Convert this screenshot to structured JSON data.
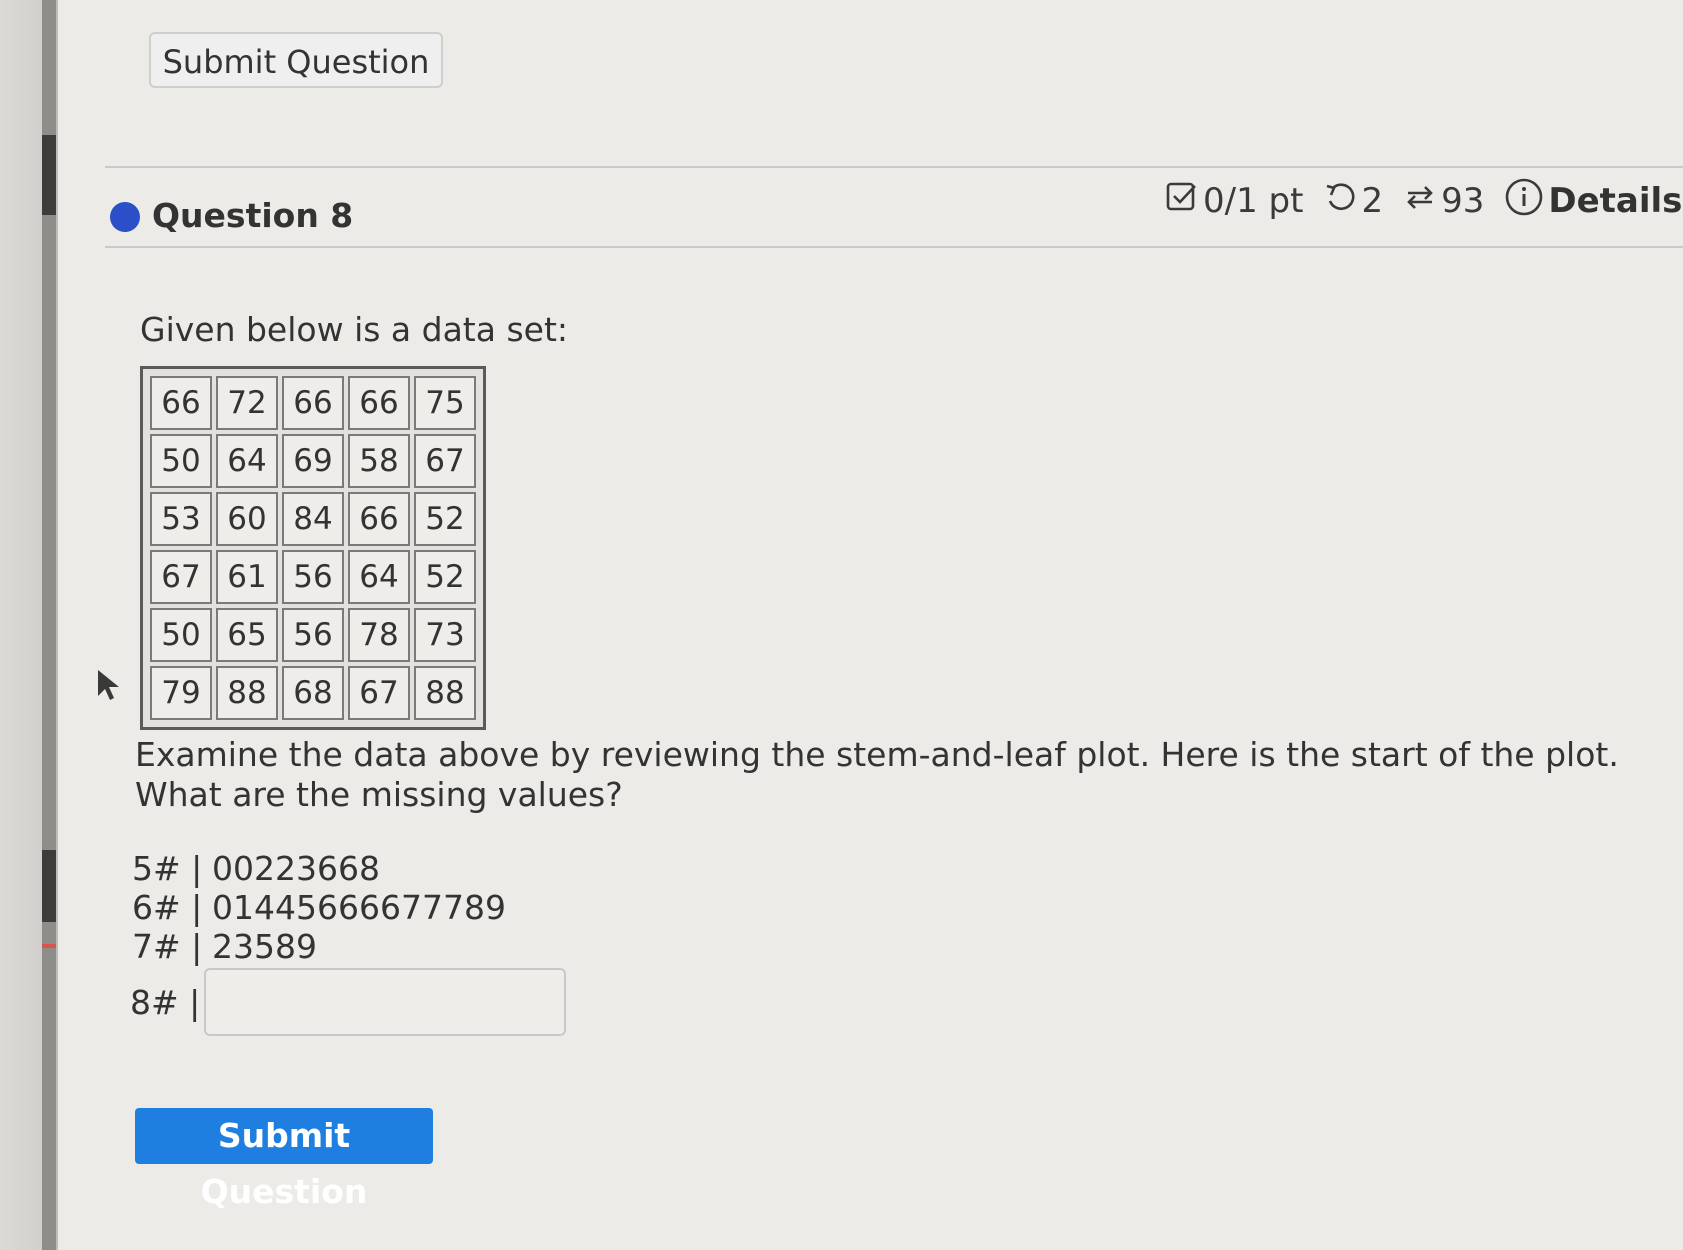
{
  "top_submit_label": "Submit Question",
  "question": {
    "title": "Question 8",
    "score": "0/1 pt",
    "retries": "2",
    "attempts": "93",
    "details_label": "Details"
  },
  "intro": "Given below is a data set:",
  "data_rows": [
    [
      "66",
      "72",
      "66",
      "66",
      "75"
    ],
    [
      "50",
      "64",
      "69",
      "58",
      "67"
    ],
    [
      "53",
      "60",
      "84",
      "66",
      "52"
    ],
    [
      "67",
      "61",
      "56",
      "64",
      "52"
    ],
    [
      "50",
      "65",
      "56",
      "78",
      "73"
    ],
    [
      "79",
      "88",
      "68",
      "67",
      "88"
    ]
  ],
  "prompt": "Examine the data above by reviewing the stem-and-leaf plot. Here is the start of the plot. What are the missing values?",
  "stem_plot": [
    {
      "stem": "5# |",
      "leaves": "00223668"
    },
    {
      "stem": "6# |",
      "leaves": "01445666677789"
    },
    {
      "stem": "7# |",
      "leaves": "23589"
    }
  ],
  "answer_row": {
    "stem": "8# |",
    "value": ""
  },
  "submit_label": "Submit Question",
  "colors": {
    "accent": "#1f7fe0",
    "question_dot": "#2b4fc9"
  },
  "icons": [
    "checkbox-icon",
    "retry-icon",
    "attempts-icon",
    "info-icon",
    "cursor-icon"
  ]
}
